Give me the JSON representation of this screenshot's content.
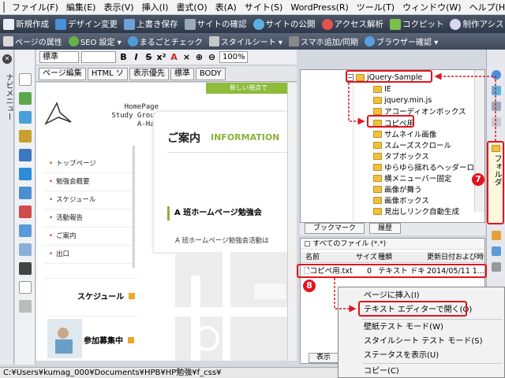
{
  "menubar": {
    "items": [
      "ファイル(F)",
      "編集(E)",
      "表示(V)",
      "挿入(I)",
      "書式(O)",
      "表(A)",
      "サイト(S)",
      "WordPress(R)",
      "ツール(T)",
      "ウィンドウ(W)",
      "ヘルプ(H)"
    ],
    "window_controls": [
      "▾",
      "✕"
    ]
  },
  "toolbar1": {
    "buttons": [
      "新規作成",
      "デザイン変更",
      "上書き保存",
      "サイトの確認",
      "サイトの公開",
      "アクセス解析",
      "コクピット",
      "制作アシスト"
    ]
  },
  "toolbar2": {
    "buttons": [
      "ページの属性",
      "SEO 設定 ▾",
      "まるごとチェック",
      "スタイルシート ▾",
      "スマホ追加/同期",
      "ブラウザー確認 ▾"
    ]
  },
  "left_strip": {
    "label": "ナビメニュー"
  },
  "format_bar": {
    "style_select": "標準",
    "size_select": "",
    "zoom": "100%",
    "icons": [
      "B",
      "I",
      "S",
      "x²",
      "A",
      "×"
    ]
  },
  "editor_tabs": {
    "tabs": [
      "ページ編集",
      "HTML ソ",
      "表示優先",
      "標準",
      "BODY"
    ]
  },
  "preview": {
    "top_banner": "新しい視点で",
    "logo_lines": [
      "HomePage",
      "Study Group",
      "A-Han"
    ],
    "nav": [
      "トップページ",
      "勉強会概要",
      "スケジュール",
      "活動報告",
      "ご案内",
      "出口"
    ],
    "title_ja": "ご案内",
    "title_en": "INFORMATION",
    "subhead": "A 班ホームページ勉強会",
    "body": "A 班ホームページ勉強会活動は",
    "schedule_label": "スケジュール",
    "recruit_label": "参加募集中"
  },
  "folder_tree": {
    "root": "jQuery-Sample",
    "items": [
      "IE",
      "jquery.min.js",
      "アコーディオンボックス",
      "コピペ用",
      "サムネイル画像",
      "スムーズスクロール",
      "タブボックス",
      "ゆらゆら揺れるヘッダーロゴ",
      "横メニューバー固定",
      "画像が舞う",
      "画像ボックス",
      "見出しリンク自動生成"
    ]
  },
  "panel_tabs": [
    "ブックマーク",
    "履歴"
  ],
  "file_list": {
    "filter": "すべてのファイル (*.*)",
    "columns": [
      "名前",
      "サイズ",
      "種類",
      "更新日付および時"
    ],
    "file": {
      "name": "コピペ用.txt",
      "size": "0",
      "type": "テキスト ドキ...",
      "date": "2014/05/11 1..."
    },
    "button": "表示"
  },
  "context_menu": {
    "items": [
      "ページに挿入(I)",
      "テキスト エディターで開く(O)",
      "壁紙テスト モード(W)",
      "スタイルシート テスト モード(S)",
      "ステータスを表示(U)",
      "コピー(C)"
    ]
  },
  "right_strip": {
    "folder_tab_label": "フォルダ"
  },
  "annotations": {
    "step7": "7",
    "step8": "8"
  },
  "statusbar": {
    "path": "C:¥Users¥kumag_000¥Documents¥HPB¥HP勉強¥f_css¥"
  },
  "colors": {
    "accent_green": "#8bb23a",
    "annotation_red": "#e0141e",
    "toolbar_dark": "#3a4456"
  }
}
